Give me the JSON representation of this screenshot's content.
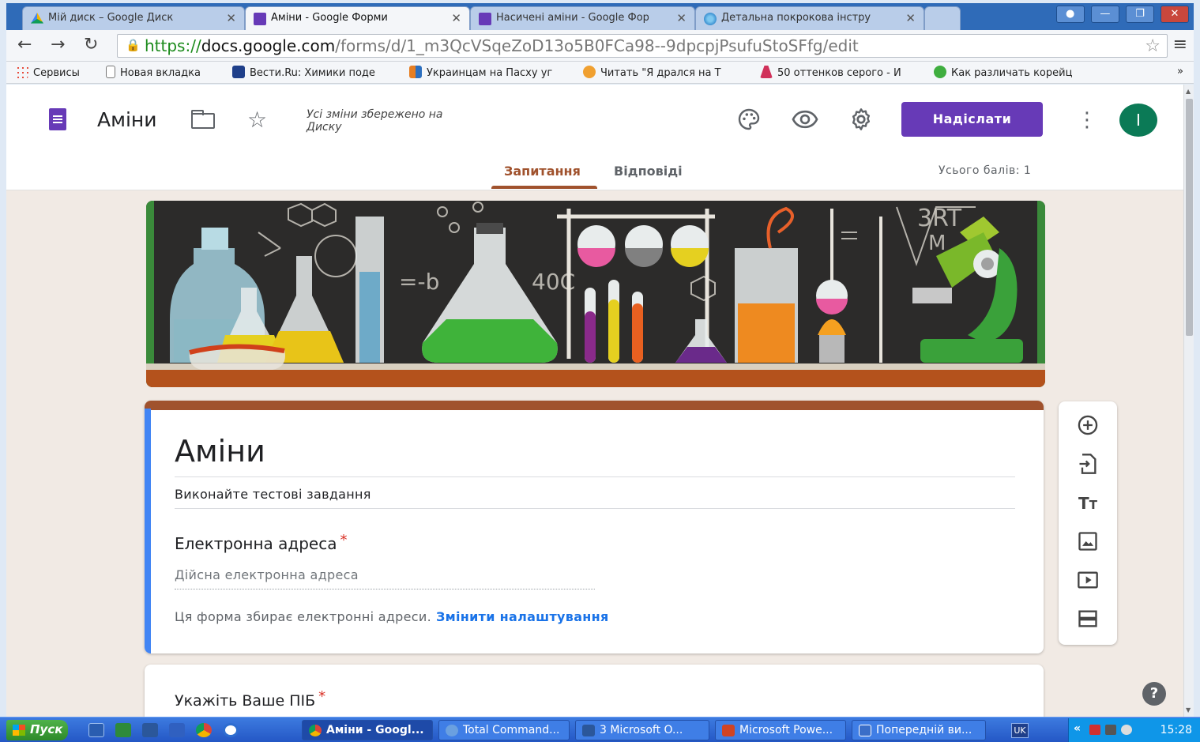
{
  "browser": {
    "tabs": [
      {
        "title": "Мій диск – Google Диск",
        "icon": "google-drive-icon",
        "active": false
      },
      {
        "title": "Аміни - Google Форми",
        "icon": "google-forms-icon",
        "active": true
      },
      {
        "title": "Насичені аміни - Google Фор",
        "icon": "google-forms-icon",
        "active": false
      },
      {
        "title": "Детальна покрокова інстру",
        "icon": "snowflake-icon",
        "active": false
      }
    ],
    "tab_close": "✕",
    "url": {
      "scheme": "https://",
      "host": "docs.google.com",
      "path": "/forms/d/1_m3QcVSqeZoD13o5B0FCa98--9dpcpjPsufuStoSFfg/edit"
    },
    "bookmarks": [
      {
        "label": "Сервисы",
        "icon": "apps-grid-icon"
      },
      {
        "label": "Новая вкладка",
        "icon": "page-icon"
      },
      {
        "label": "Вести.Ru: Химики поде",
        "icon": "vesti-icon"
      },
      {
        "label": "Украинцам на Пасху уг",
        "icon": "news-icon"
      },
      {
        "label": "Читать \"Я дрался на Т",
        "icon": "book-icon"
      },
      {
        "label": "50 оттенков серого - И",
        "icon": "dress-icon"
      },
      {
        "label": "Как различать корейц",
        "icon": "f-icon"
      }
    ],
    "bookmarks_more": "»"
  },
  "forms": {
    "name": "Аміни",
    "save_status": "Усі зміни збережено на Диску",
    "send_label": "Надіслати",
    "avatar_initial": "I",
    "tabs": {
      "questions": "Запитання",
      "responses": "Відповіді"
    },
    "total_points": "Усього балів: 1",
    "accent_color": "#a0522d",
    "brand_color": "#673ab7"
  },
  "form": {
    "title": "Аміни",
    "description": "Виконайте тестові завдання",
    "email_question": {
      "label": "Електронна адреса",
      "required_mark": "*",
      "placeholder": "Дійсна електронна адреса",
      "note": "Ця форма збирає електронні адреси.",
      "link": "Змінити налаштування"
    },
    "question2": {
      "label": "Укажіть Ваше ПІБ",
      "required_mark": "*"
    }
  },
  "sidetools": [
    "add-question-icon",
    "import-questions-icon",
    "add-title-icon",
    "add-image-icon",
    "add-video-icon",
    "add-section-icon"
  ],
  "taskbar": {
    "start_label": "Пуск",
    "tasks": [
      {
        "label": "Аміни - Googl...",
        "active": true
      },
      {
        "label": "Total Command...",
        "active": false
      },
      {
        "label": "3 Microsoft O...",
        "active": false
      },
      {
        "label": "Microsoft Powe...",
        "active": false
      },
      {
        "label": "Попередній ви...",
        "active": false
      }
    ],
    "language": "UK",
    "tray_chevron": "«",
    "clock": "15:28"
  }
}
